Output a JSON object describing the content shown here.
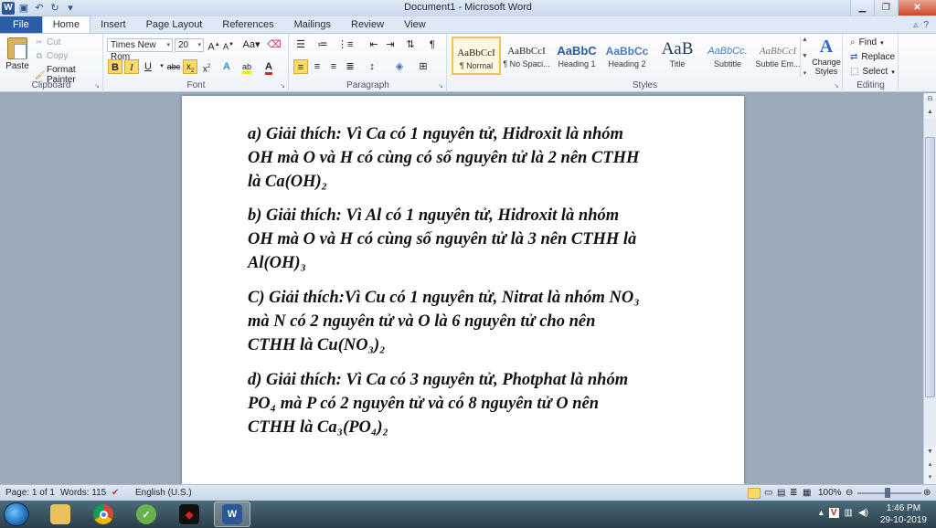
{
  "titlebar": {
    "title": "Document1 - Microsoft Word",
    "app_icon": "W"
  },
  "tabs": [
    "File",
    "Home",
    "Insert",
    "Page Layout",
    "References",
    "Mailings",
    "Review",
    "View"
  ],
  "active_tab": "Home",
  "clipboard": {
    "paste": "Paste",
    "cut": "Cut",
    "copy": "Copy",
    "format_painter": "Format Painter",
    "group": "Clipboard"
  },
  "font": {
    "name": "Times New Rom",
    "size": "20",
    "group": "Font",
    "case_label": "Aa"
  },
  "paragraph": {
    "group": "Paragraph"
  },
  "styles": {
    "group": "Styles",
    "items": [
      {
        "sample": "AaBbCcI",
        "name": "¶ Normal"
      },
      {
        "sample": "AaBbCcI",
        "name": "¶ No Spaci..."
      },
      {
        "sample": "AaBbC",
        "name": "Heading 1"
      },
      {
        "sample": "AaBbCc",
        "name": "Heading 2"
      },
      {
        "sample": "AaB",
        "name": "Title"
      },
      {
        "sample": "AaBbCc.",
        "name": "Subtitle"
      },
      {
        "sample": "AaBbCcI",
        "name": "Subtle Em..."
      }
    ],
    "change_styles": "Change Styles"
  },
  "editing": {
    "group": "Editing",
    "find": "Find",
    "replace": "Replace",
    "select": "Select"
  },
  "document": {
    "paragraphs": [
      {
        "lines": [
          " a) Giải thích: Vì Ca có 1 nguyên tử, Hidroxit là nhóm",
          "OH mà O và H có cùng có số nguyên tử là 2 nên CTHH",
          "là Ca(OH)₂"
        ]
      },
      {
        "lines": [
          " b)  Giải thích: Vì Al có 1 nguyên tử, Hidroxit là nhóm",
          "OH mà O và H có cùng số nguyên tử là 3 nên CTHH là",
          "Al(OH)₃"
        ]
      },
      {
        "lines": [
          "C) Giải thích:Vì Cu có 1 nguyên tử, Nitrat là nhóm NO₃",
          "mà N có 2 nguyên tử và O là 6 nguyên tử cho nên",
          "CTHH là Cu(NO₃)₂"
        ]
      },
      {
        "lines": [
          "d) Giải thích: Vì Ca có 3 nguyên tử, Photphat là nhóm",
          "PO₄ mà P có 2 nguyên tử và có 8 nguyên tử O nên",
          "CTHH là Ca₃(PO₄)₂"
        ]
      }
    ]
  },
  "statusbar": {
    "page": "Page: 1 of 1",
    "words": "Words: 115",
    "language": "English (U.S.)",
    "zoom": "100%"
  },
  "taskbar": {
    "time": "1:46 PM",
    "date": "29-10-2019"
  }
}
